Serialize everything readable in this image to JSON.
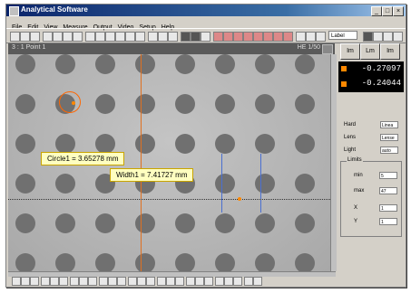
{
  "app": {
    "title": "Analytical Software"
  },
  "menu": [
    "File",
    "Edit",
    "View",
    "Measure",
    "Output",
    "Video",
    "Setup",
    "Help"
  ],
  "toolbar": {
    "unit": "Label"
  },
  "view": {
    "title": "3 : 1  Point 1",
    "zoom": "HE 1/50"
  },
  "measurements": [
    {
      "label": "Circle1 = 3.65278 mm"
    },
    {
      "label": "Width1 = 7.41727 mm"
    }
  ],
  "coords": {
    "x": "-0.27097",
    "y": "-0.24044"
  },
  "panel": {
    "tabs": [
      "Im",
      "Lm",
      "Im"
    ],
    "fields": [
      {
        "label": "Hard",
        "value": "Linea"
      },
      {
        "label": "Lens",
        "value": "Lense"
      },
      {
        "label": "Light",
        "value": "auto"
      }
    ],
    "group": "Limits",
    "sub": [
      {
        "label": "min",
        "value": "5"
      },
      {
        "label": "max",
        "value": "47"
      },
      {
        "label": "X",
        "value": "1"
      },
      {
        "label": "Y",
        "value": "1"
      }
    ]
  }
}
